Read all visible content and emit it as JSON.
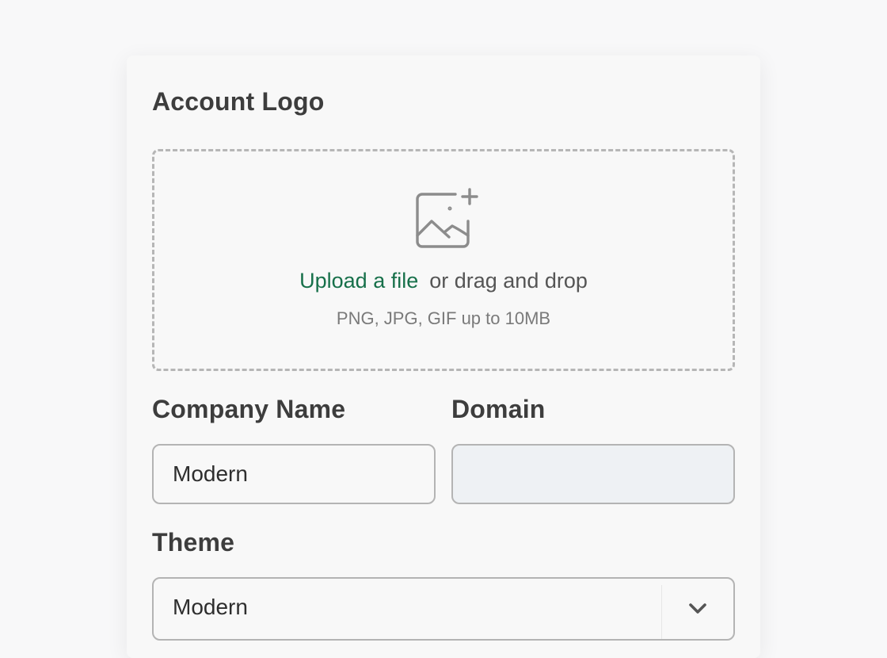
{
  "account_logo": {
    "label": "Account Logo",
    "dropzone": {
      "icon": "image-plus-icon",
      "upload_link": "Upload a file",
      "upload_rest": "or drag and drop",
      "hint": "PNG, JPG, GIF up to 10MB"
    }
  },
  "company_name": {
    "label": "Company Name",
    "value": "Modern"
  },
  "domain": {
    "label": "Domain",
    "value": ""
  },
  "theme": {
    "label": "Theme",
    "selected": "Modern",
    "icon": "chevron-down-icon"
  },
  "colors": {
    "accent": "#17704a",
    "border": "#b4b4b4",
    "disabled_bg": "#eef1f4"
  }
}
